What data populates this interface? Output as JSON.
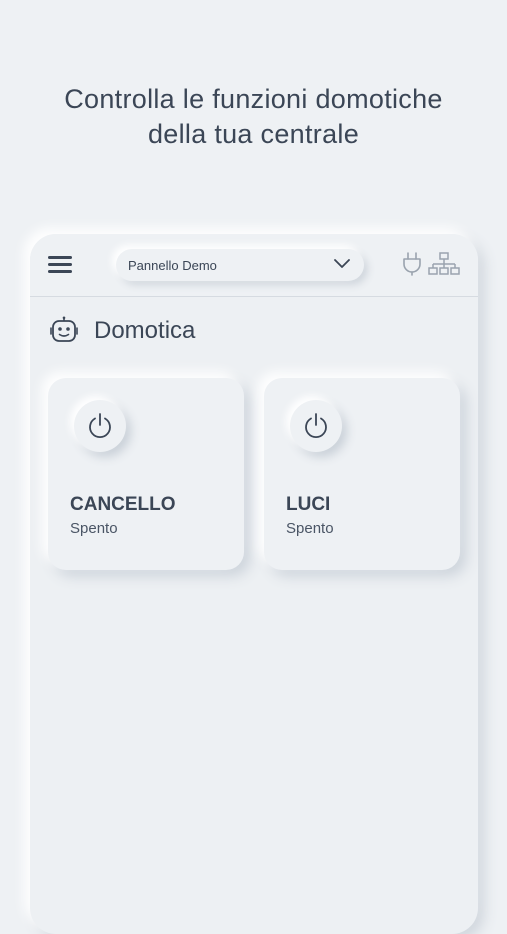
{
  "promo": {
    "line1": "Controlla le funzioni domotiche",
    "line2": "della tua centrale"
  },
  "topbar": {
    "panel_selected": "Pannello Demo",
    "icons": [
      "menu-icon",
      "chevron-down-icon",
      "plug-icon",
      "network-icon"
    ]
  },
  "section": {
    "title": "Domotica",
    "icon": "robot-icon"
  },
  "devices": [
    {
      "name": "CANCELLO",
      "status": "Spento",
      "icon": "power-icon"
    },
    {
      "name": "LUCI",
      "status": "Spento",
      "icon": "power-icon"
    }
  ],
  "colors": {
    "background": "#eef1f4",
    "text": "#3b4656",
    "icon_muted": "#9aa3ae"
  }
}
